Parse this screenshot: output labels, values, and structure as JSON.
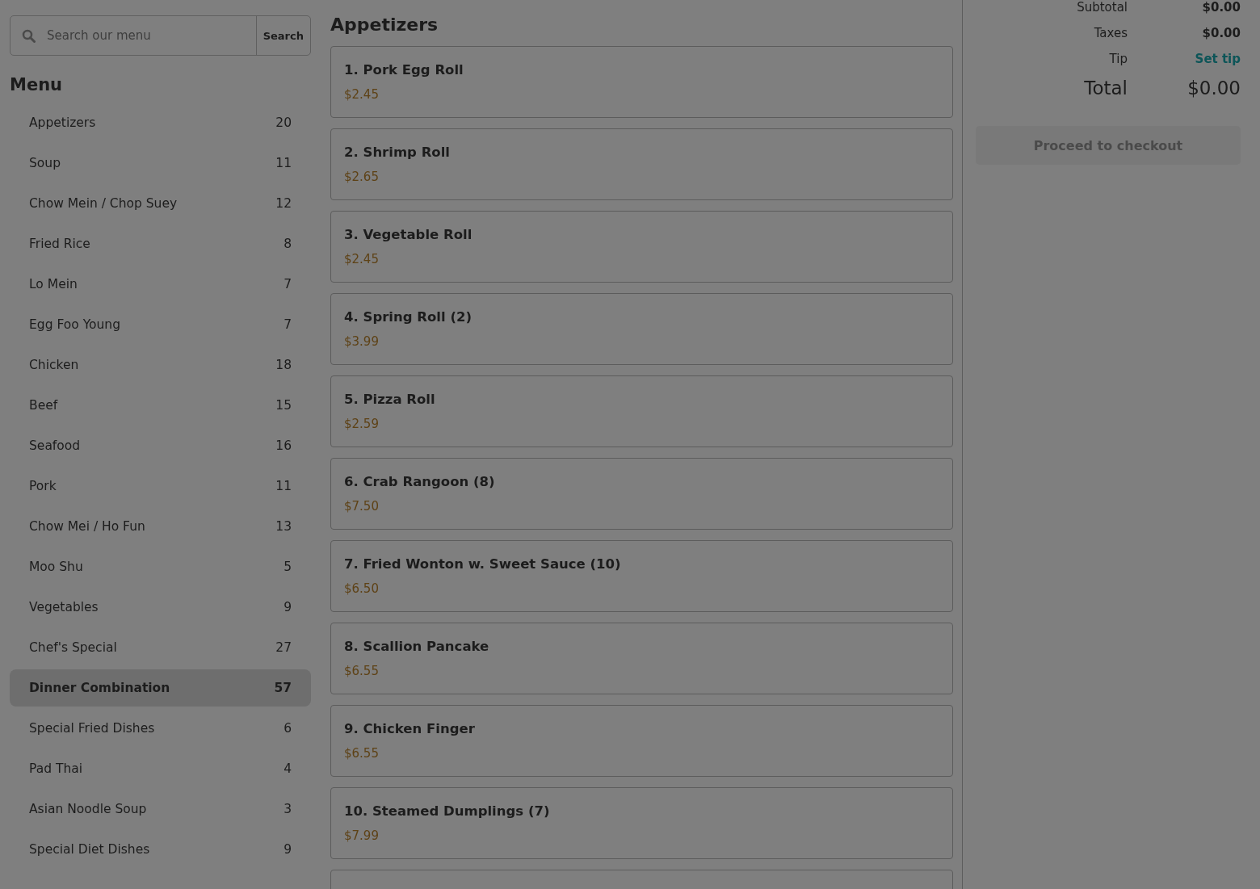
{
  "search": {
    "placeholder": "Search our menu",
    "button": "Search"
  },
  "sidebar": {
    "title": "Menu",
    "items": [
      {
        "label": "Appetizers",
        "count": "20",
        "selected": false
      },
      {
        "label": "Soup",
        "count": "11",
        "selected": false
      },
      {
        "label": "Chow Mein / Chop Suey",
        "count": "12",
        "selected": false
      },
      {
        "label": "Fried Rice",
        "count": "8",
        "selected": false
      },
      {
        "label": "Lo Mein",
        "count": "7",
        "selected": false
      },
      {
        "label": "Egg Foo Young",
        "count": "7",
        "selected": false
      },
      {
        "label": "Chicken",
        "count": "18",
        "selected": false
      },
      {
        "label": "Beef",
        "count": "15",
        "selected": false
      },
      {
        "label": "Seafood",
        "count": "16",
        "selected": false
      },
      {
        "label": "Pork",
        "count": "11",
        "selected": false
      },
      {
        "label": "Chow Mei / Ho Fun",
        "count": "13",
        "selected": false
      },
      {
        "label": "Moo Shu",
        "count": "5",
        "selected": false
      },
      {
        "label": "Vegetables",
        "count": "9",
        "selected": false
      },
      {
        "label": "Chef's Special",
        "count": "27",
        "selected": false
      },
      {
        "label": "Dinner Combination",
        "count": "57",
        "selected": true
      },
      {
        "label": "Special Fried Dishes",
        "count": "6",
        "selected": false
      },
      {
        "label": "Pad Thai",
        "count": "4",
        "selected": false
      },
      {
        "label": "Asian Noodle Soup",
        "count": "3",
        "selected": false
      },
      {
        "label": "Special Diet Dishes",
        "count": "9",
        "selected": false
      }
    ]
  },
  "section": {
    "title": "Appetizers",
    "items": [
      {
        "name": "1. Pork Egg Roll",
        "price": "$2.45"
      },
      {
        "name": "2. Shrimp Roll",
        "price": "$2.65"
      },
      {
        "name": "3. Vegetable Roll",
        "price": "$2.45"
      },
      {
        "name": "4. Spring Roll (2)",
        "price": "$3.99"
      },
      {
        "name": "5. Pizza Roll",
        "price": "$2.59"
      },
      {
        "name": "6. Crab Rangoon (8)",
        "price": "$7.50"
      },
      {
        "name": "7. Fried Wonton w. Sweet Sauce (10)",
        "price": "$6.50"
      },
      {
        "name": "8. Scallion Pancake",
        "price": "$6.55"
      },
      {
        "name": "9. Chicken Finger",
        "price": "$6.55"
      },
      {
        "name": "10. Steamed Dumplings (7)",
        "price": "$7.99"
      }
    ]
  },
  "cart": {
    "rows": [
      {
        "label": "Subtotal",
        "value": "$0.00",
        "kind": "amount"
      },
      {
        "label": "Taxes",
        "value": "$0.00",
        "kind": "amount"
      },
      {
        "label": "Tip",
        "value": "Set tip",
        "kind": "link"
      },
      {
        "label": "Total",
        "value": "$0.00",
        "kind": "total"
      }
    ],
    "checkout": {
      "label": "Proceed to checkout",
      "disabled": true
    }
  }
}
